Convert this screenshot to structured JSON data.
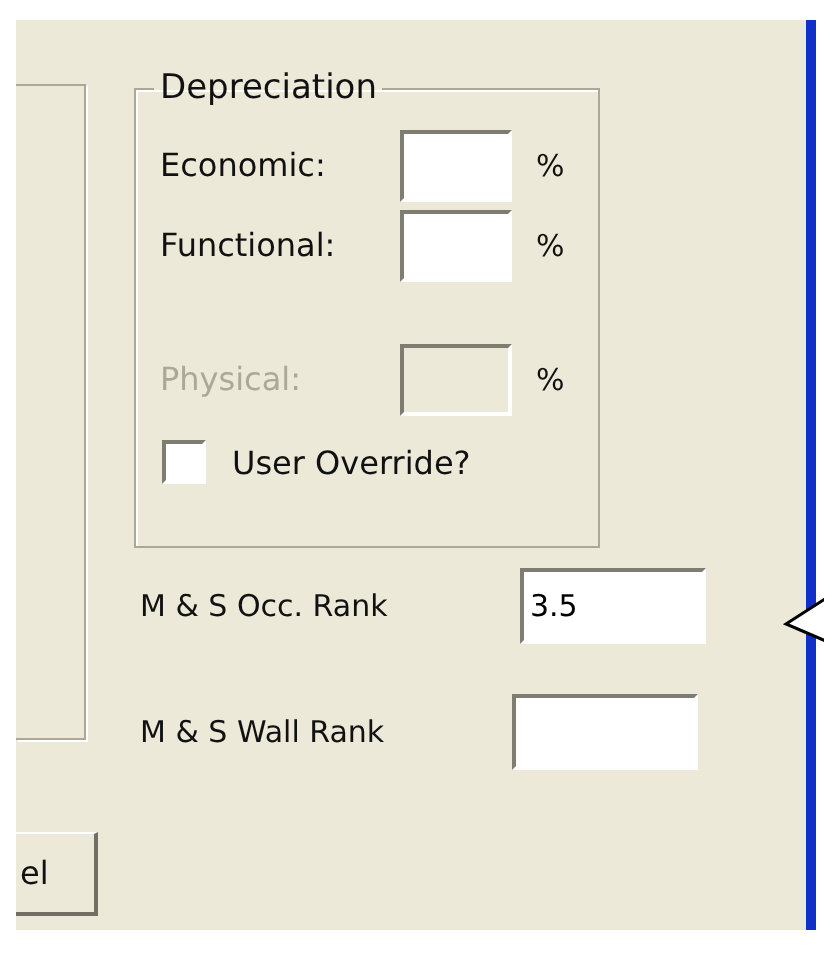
{
  "depreciation": {
    "title": "Depreciation",
    "fields": [
      {
        "label": "Economic:",
        "unit": "%",
        "disabled": false
      },
      {
        "label": "Functional:",
        "unit": "%",
        "disabled": false
      },
      {
        "label": "Physical:",
        "unit": "%",
        "disabled": true
      }
    ],
    "override": {
      "label": "User Override?",
      "checked": false
    }
  },
  "ranks": [
    {
      "label": "M & S Occ. Rank",
      "value": "3.5"
    },
    {
      "label": "M & S Wall Rank"
    }
  ],
  "button": {
    "label": "el"
  }
}
